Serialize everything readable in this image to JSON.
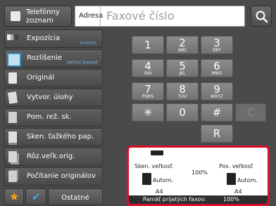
{
  "top": {
    "phonebook_label": "Telefónny zoznam",
    "address_label": "Adresa",
    "address_placeholder": "Faxové číslo",
    "search_icon": "search-icon"
  },
  "sidebar": {
    "items": [
      {
        "label": "Expozícia",
        "sub": "Autom.",
        "icon": "exposure-icon"
      },
      {
        "label": "Rozlíšenie",
        "sub": "Veľmi jemné",
        "icon": "resolution-icon"
      },
      {
        "label": "Originál",
        "sub": "",
        "icon": "original-icon"
      },
      {
        "label": "Vytvor. úlohy",
        "sub": "",
        "icon": "job-build-icon"
      },
      {
        "label": "Pom. rež. sk.",
        "sub": "",
        "icon": "slow-scan-icon"
      },
      {
        "label": "Sken. ťažkého pap.",
        "sub": "",
        "icon": "heavy-paper-icon"
      },
      {
        "label": "Rôz.veľk.orig.",
        "sub": "",
        "icon": "mixed-size-icon"
      },
      {
        "label": "Počítanie originálov",
        "sub": "",
        "icon": "count-icon"
      }
    ],
    "bottom": {
      "star_icon": "star-icon",
      "check_icon": "checkmark-icon",
      "other_label": "Ostatné"
    }
  },
  "keypad": {
    "keys": [
      {
        "num": "1",
        "letters": ""
      },
      {
        "num": "2",
        "letters": "ABC"
      },
      {
        "num": "3",
        "letters": "DEF"
      },
      {
        "num": "4",
        "letters": "GHI"
      },
      {
        "num": "5",
        "letters": "JKL"
      },
      {
        "num": "6",
        "letters": "MNO"
      },
      {
        "num": "7",
        "letters": "PQRS"
      },
      {
        "num": "8",
        "letters": "TUV"
      },
      {
        "num": "9",
        "letters": "WXYZ"
      },
      {
        "num": "✳",
        "letters": ""
      },
      {
        "num": "0",
        "letters": ""
      },
      {
        "num": "#",
        "letters": ""
      }
    ],
    "clear": "C",
    "recall": "R"
  },
  "info": {
    "scan_size_label": "Sken. veľkosť",
    "send_size_label": "Pos. veľkosť",
    "ratio": "100%",
    "scan_auto": "Autom.",
    "send_auto": "Autom.",
    "scan_paper": "A4",
    "send_paper": "A4",
    "memory_label": "Pamäť prijatých faxov:",
    "memory_value": "100%",
    "highlight_color": "#d8102b"
  }
}
